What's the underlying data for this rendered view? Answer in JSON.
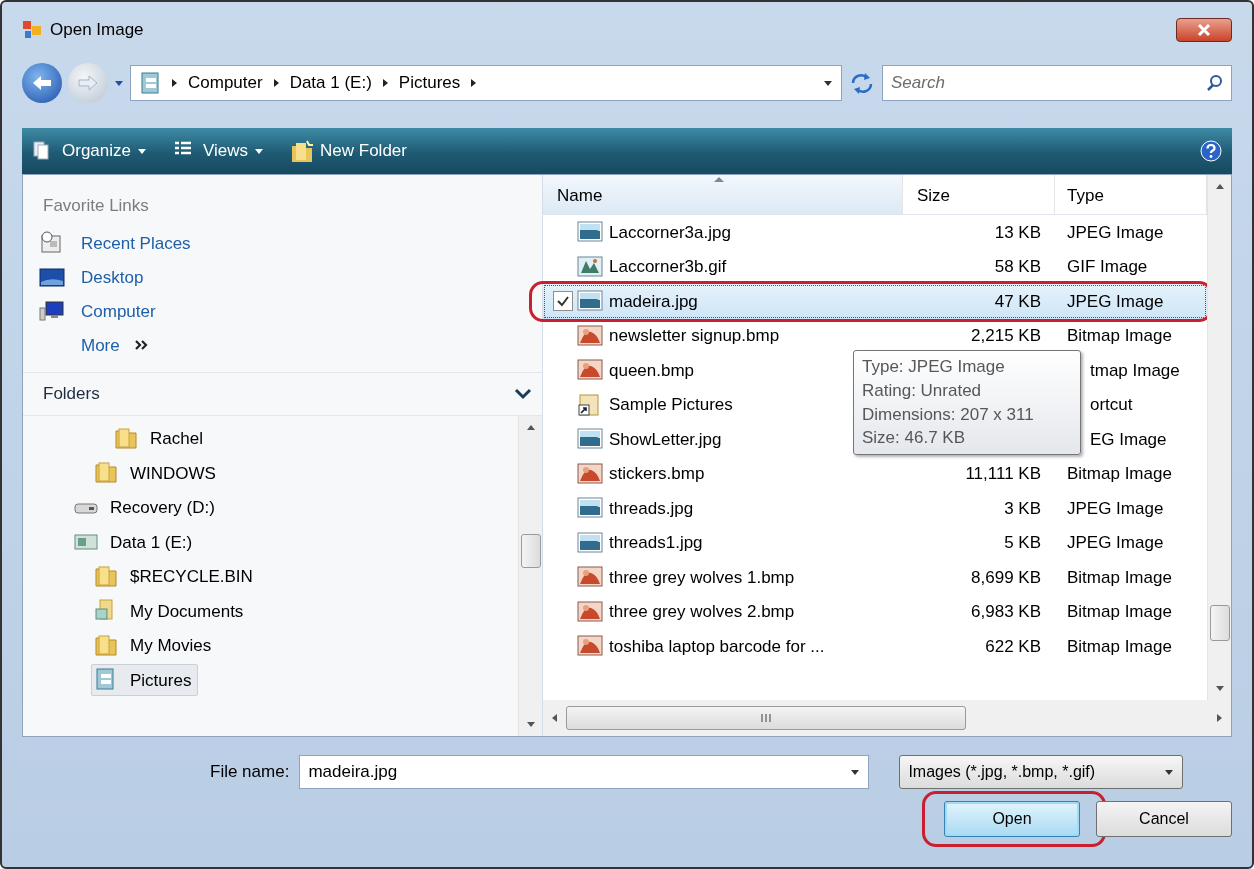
{
  "window": {
    "title": "Open Image"
  },
  "address": {
    "crumbs": [
      "Computer",
      "Data 1 (E:)",
      "Pictures"
    ],
    "search_placeholder": "Search"
  },
  "toolbar": {
    "items": [
      {
        "label": "Organize",
        "kind": "organize",
        "dropdown": true
      },
      {
        "label": "Views",
        "kind": "views",
        "dropdown": true
      },
      {
        "label": "New Folder",
        "kind": "new-folder",
        "dropdown": false
      }
    ]
  },
  "favorite_links": {
    "heading": "Favorite Links",
    "items": [
      {
        "label": "Recent Places",
        "kind": "recent"
      },
      {
        "label": "Desktop",
        "kind": "desktop"
      },
      {
        "label": "Computer",
        "kind": "computer"
      }
    ],
    "more": "More"
  },
  "folders": {
    "heading": "Folders",
    "expanded": true,
    "tree": [
      {
        "children": [
          {
            "children": [
              {
                "label": "Rachel",
                "kind": "folder",
                "selected": false
              }
            ]
          },
          {
            "label": "WINDOWS",
            "kind": "folder",
            "selected": false
          }
        ]
      },
      {
        "label": "Recovery (D:)",
        "kind": "drive",
        "selected": false
      },
      {
        "label": "Data 1 (E:)",
        "kind": "data-drive",
        "selected": false,
        "children": [
          {
            "label": "$RECYCLE.BIN",
            "kind": "folder",
            "selected": false
          },
          {
            "label": "My Documents",
            "kind": "documents",
            "selected": false
          },
          {
            "label": "My Movies",
            "kind": "folder",
            "selected": false
          },
          {
            "label": "Pictures",
            "kind": "pictures",
            "selected": true
          }
        ]
      }
    ]
  },
  "file_list": {
    "columns": [
      {
        "label": "Name",
        "sorted": true
      },
      {
        "label": "Size",
        "sorted": false
      },
      {
        "label": "Type",
        "sorted": false
      }
    ],
    "rows": [
      {
        "name": "Laccorner3a.jpg",
        "size": "13 KB",
        "type": "JPEG Image",
        "kind": "jpeg",
        "selected": false,
        "checked": false,
        "circled": false
      },
      {
        "name": "Laccorner3b.gif",
        "size": "58 KB",
        "type": "GIF Image",
        "kind": "gif",
        "selected": false,
        "checked": false,
        "circled": false
      },
      {
        "name": "madeira.jpg",
        "size": "47 KB",
        "type": "JPEG Image",
        "kind": "jpeg",
        "selected": true,
        "checked": true,
        "circled": true
      },
      {
        "name": "newsletter signup.bmp",
        "size": "2,215 KB",
        "type": "Bitmap Image",
        "kind": "bitmap",
        "selected": false,
        "checked": false,
        "circled": false
      },
      {
        "name": "queen.bmp",
        "type": "tmap Image",
        "type_clipped": true,
        "kind": "bitmap",
        "selected": false,
        "checked": false,
        "circled": false
      },
      {
        "name": "Sample Pictures",
        "type": "ortcut",
        "type_clipped": true,
        "kind": "shortcut",
        "selected": false,
        "checked": false,
        "circled": false
      },
      {
        "name": "ShowLetter.jpg",
        "type": "EG Image",
        "type_clipped": true,
        "kind": "jpeg",
        "selected": false,
        "checked": false,
        "circled": false
      },
      {
        "name": "stickers.bmp",
        "size": "11,111 KB",
        "type": "Bitmap Image",
        "kind": "bitmap",
        "selected": false,
        "checked": false,
        "circled": false
      },
      {
        "name": "threads.jpg",
        "size": "3 KB",
        "type": "JPEG Image",
        "kind": "jpeg",
        "selected": false,
        "checked": false,
        "circled": false
      },
      {
        "name": "threads1.jpg",
        "size": "5 KB",
        "type": "JPEG Image",
        "kind": "jpeg",
        "selected": false,
        "checked": false,
        "circled": false
      },
      {
        "name": "three grey wolves 1.bmp",
        "size": "8,699 KB",
        "type": "Bitmap Image",
        "kind": "bitmap",
        "selected": false,
        "checked": false,
        "circled": false
      },
      {
        "name": "three grey wolves 2.bmp",
        "size": "6,983 KB",
        "type": "Bitmap Image",
        "kind": "bitmap",
        "selected": false,
        "checked": false,
        "circled": false
      },
      {
        "name": "toshiba laptop barcode for ...",
        "size": "622 KB",
        "type": "Bitmap Image",
        "kind": "bitmap",
        "selected": false,
        "checked": false,
        "circled": false
      }
    ],
    "tooltip": [
      "Type: JPEG Image",
      "Rating: Unrated",
      "Dimensions: 207 x 311",
      "Size: 46.7 KB"
    ]
  },
  "bottom": {
    "file_name_label": "File name:",
    "file_name": "madeira.jpg",
    "file_type": "Images (*.jpg, *.bmp, *.gif)",
    "buttons": [
      {
        "label": "Open",
        "kind": "default",
        "circled": true
      },
      {
        "label": "Cancel",
        "kind": "normal",
        "circled": false
      }
    ]
  }
}
